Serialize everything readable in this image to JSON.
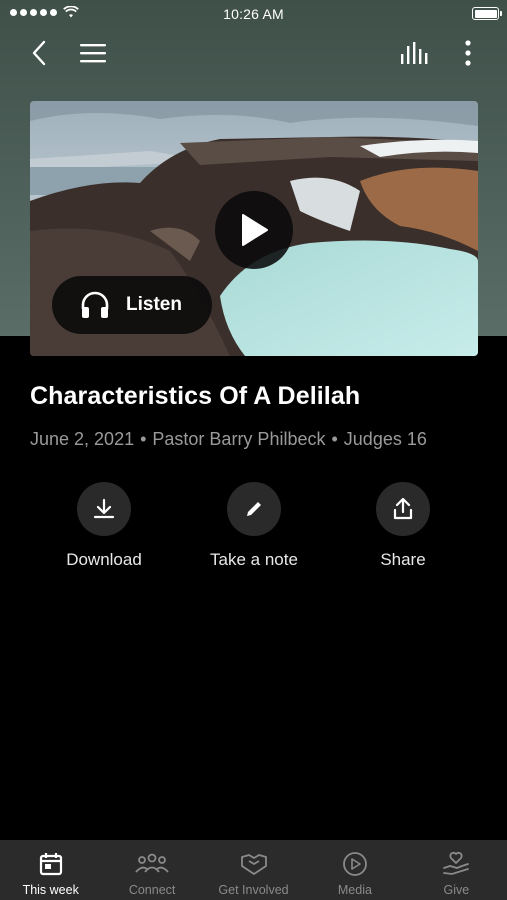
{
  "status_bar": {
    "time": "10:26 AM"
  },
  "nav": {
    "back_icon": "chevron-left-icon",
    "menu_icon": "hamburger-menu-icon",
    "audio_icon": "audio-bars-icon",
    "more_icon": "more-vertical-icon"
  },
  "media": {
    "play_icon": "play-icon",
    "listen_label": "Listen",
    "listen_icon": "headphones-icon"
  },
  "sermon": {
    "title": "Characteristics Of A Delilah",
    "date": "June 2, 2021",
    "separator": "•",
    "speaker": "Pastor Barry Philbeck",
    "scripture": "Judges 16"
  },
  "actions": [
    {
      "label": "Download",
      "icon": "download-icon"
    },
    {
      "label": "Take a note",
      "icon": "pencil-icon"
    },
    {
      "label": "Share",
      "icon": "share-icon"
    }
  ],
  "tabs": [
    {
      "label": "This week",
      "icon": "calendar-icon",
      "active": true
    },
    {
      "label": "Connect",
      "icon": "people-icon",
      "active": false
    },
    {
      "label": "Get Involved",
      "icon": "handshake-icon",
      "active": false
    },
    {
      "label": "Media",
      "icon": "play-circle-icon",
      "active": false
    },
    {
      "label": "Give",
      "icon": "heart-hand-icon",
      "active": false
    }
  ],
  "colors": {
    "header_bg": "#4e605a",
    "page_bg": "#000000",
    "tab_bar_bg": "#2b2b2b",
    "meta_text": "#9a9a9a",
    "inactive_tab": "#8a8a8a"
  }
}
